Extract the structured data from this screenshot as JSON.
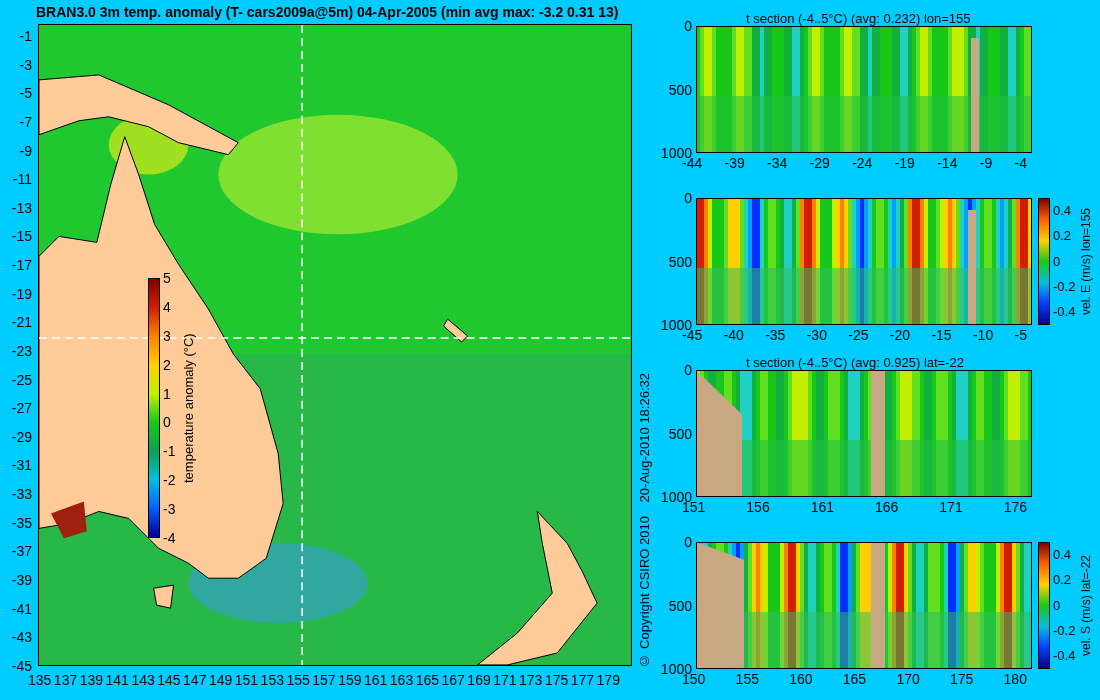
{
  "title": "BRAN3.0 3m temp. anomaly (T- cars2009a@5m) 04-Apr-2005 (min avg max: -3.2 0.31 13)",
  "map": {
    "yticks": [
      "-1",
      "-3",
      "-5",
      "-7",
      "-9",
      "-11",
      "-13",
      "-15",
      "-17",
      "-19",
      "-21",
      "-23",
      "-25",
      "-27",
      "-29",
      "-31",
      "-33",
      "-35",
      "-37",
      "-39",
      "-41",
      "-43",
      "-45"
    ],
    "xticks": [
      "135",
      "137",
      "139",
      "141",
      "143",
      "145",
      "147",
      "149",
      "151",
      "153",
      "155",
      "157",
      "159",
      "161",
      "163",
      "165",
      "167",
      "169",
      "171",
      "173",
      "175",
      "177",
      "179"
    ],
    "colorbar": {
      "label": "temperature anomaly (°C)",
      "ticks": [
        "5",
        "4",
        "3",
        "2",
        "1",
        "0",
        "-1",
        "-2",
        "-3",
        "-4"
      ]
    }
  },
  "credit": [
    "© Copyright CSIRO 2010",
    "20-Aug-2010 18:26:32"
  ],
  "panels": [
    {
      "title": "t section (-4..5°C) (avg: 0.232) lon=155",
      "kind": "temp",
      "yticks": [
        "0",
        "500",
        "1000"
      ],
      "xticks": [
        "-44",
        "-39",
        "-34",
        "-29",
        "-24",
        "-19",
        "-14",
        "-9",
        "-4"
      ]
    },
    {
      "kind": "velocity",
      "yticks": [
        "0",
        "500",
        "1000"
      ],
      "xticks": [
        "-45",
        "-40",
        "-35",
        "-30",
        "-25",
        "-20",
        "-15",
        "-10",
        "-5"
      ],
      "colorbar": {
        "label": "vel. E (m/s) lon=155",
        "ticks": [
          "0.4",
          "0.2",
          "0",
          "-0.2",
          "-0.4"
        ]
      }
    },
    {
      "title": "t section (-4..5°C) (avg: 0.925) lat=-22",
      "kind": "temp",
      "yticks": [
        "0",
        "500",
        "1000"
      ],
      "xticks": [
        "151",
        "156",
        "161",
        "166",
        "171",
        "176"
      ]
    },
    {
      "kind": "velocity",
      "yticks": [
        "0",
        "500",
        "1000"
      ],
      "xticks": [
        "150",
        "155",
        "160",
        "165",
        "170",
        "175",
        "180"
      ],
      "colorbar": {
        "label": "vel. S (m/s) lat=-22",
        "ticks": [
          "0.4",
          "0.2",
          "0",
          "-0.2",
          "-0.4"
        ]
      }
    }
  ]
}
